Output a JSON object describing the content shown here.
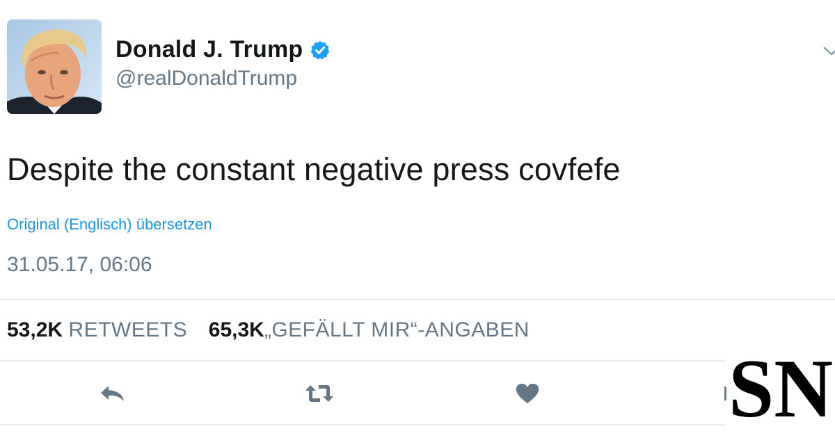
{
  "tweet": {
    "author_name": "Donald J. Trump",
    "author_handle": "@realDonaldTrump",
    "text": "Despite the constant negative press covfefe",
    "translate_label": "Original (Englisch) übersetzen",
    "timestamp": "31.05.17, 06:06"
  },
  "stats": {
    "retweets_count": "53,2K",
    "retweets_label": "RETWEETS",
    "likes_count": "65,3K",
    "likes_label": "„GEFÄLLT MIR“-ANGABEN"
  },
  "actions": {
    "reply_icon": "reply-icon",
    "retweet_icon": "retweet-icon",
    "like_icon": "heart-icon",
    "dm_icon": "direct-message-icon"
  },
  "icons": {
    "verified": "verified-badge-icon",
    "caret": "chevron-down-icon"
  },
  "logo": {
    "text": "SN"
  },
  "colors": {
    "text_primary": "#14171a",
    "text_secondary": "#657786",
    "link": "#1b95e0",
    "verified": "#1da1f2",
    "action_icon": "#657786",
    "divider": "#e6ecf0",
    "logo": "#000000"
  }
}
